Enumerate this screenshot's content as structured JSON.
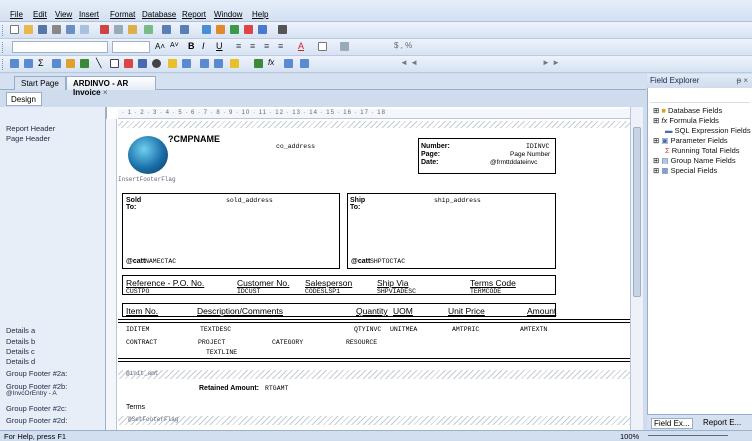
{
  "menu": {
    "file": "File",
    "edit": "Edit",
    "view": "View",
    "insert": "Insert",
    "format": "Format",
    "database": "Database",
    "report": "Report",
    "window": "Window",
    "help": "Help"
  },
  "tabs": {
    "start": "Start Page",
    "active": "ARDINVO - AR Invoice",
    "close": "×"
  },
  "design_tab": "Design",
  "sections": {
    "report_header": "Report Header",
    "page_header": "Page Header",
    "details_a": "Details a",
    "details_b": "Details b",
    "details_c": "Details c",
    "details_d": "Details d",
    "gf2a": "Group Footer #2a:",
    "gf2b": "Group Footer #2b:",
    "gf2b_sub": "@InvcOrEntry - A",
    "gf2c": "Group Footer #2c:",
    "gf2d": "Group Footer #2d:"
  },
  "ruler_text": "· 1 · 2 · 3 · 4 · 5 · 6 · 7 · 8 · 9 · 10 · 11 · 12 · 13 · 14 · 15 · 16 · 17 · 18",
  "report": {
    "company": "?CMPNAME",
    "co_address": "co_address",
    "insert_footer": "InsertFooterFlag",
    "number_lbl": "Number:",
    "page_lbl": "Page:",
    "date_lbl": "Date:",
    "idinvc": "IDINVC",
    "page_number": "Page Number",
    "date_field": "@frmttddateinvc",
    "sold_lbl": "Sold\nTo:",
    "sold_address": "sold_address",
    "ship_lbl": "Ship\nTo:",
    "ship_address": "ship_address",
    "attn_sold": "@catt",
    "namectac": "NAMECTAC",
    "attn_ship": "@catt",
    "shptoctac": "SHPTOCTAC",
    "ref_po": "Reference - P.O. No.",
    "customer_no": "Customer No.",
    "salesperson": "Salesperson",
    "ship_via": "Ship Via",
    "terms_code": "Terms Code",
    "custpo": "CUSTPO",
    "idcust": "IDCUST",
    "codeslsp1": "CODESLSP1",
    "shpviadesc": "SHPVIADESC",
    "termcode": "TERMCODE",
    "item_no": "Item No.",
    "description": "Description/Comments",
    "quantity": "Quantity",
    "uom": "UOM",
    "unit_price": "Unit Price",
    "amount": "Amount",
    "iditem": "IDITEM",
    "textdesc": "TEXTDESC",
    "qtyinvc": "QTYINVC",
    "unitmeas": "UNITMEA",
    "amtpric": "AMTPRIC",
    "amtextn": "AMTEXTN",
    "contract": "CONTRACT",
    "project": "PROJECT",
    "category": "CATEGORY",
    "resource": "RESOURCE",
    "textline": "TEXTLINE",
    "insert_amt": "@init_amt",
    "retained_lbl": "Retained Amount:",
    "rtgamt": "RTGAMT",
    "terms": "Terms",
    "set_footer": "@SetFooterFlag"
  },
  "explorer": {
    "title": "Field Explorer",
    "pin": "ᵽ ×",
    "items": [
      "Database Fields",
      "Formula Fields",
      "SQL Expression Fields",
      "Parameter Fields",
      "Running Total Fields",
      "Group Name Fields",
      "Special Fields"
    ],
    "bottom_tab1": "Field Ex...",
    "bottom_tab2": "Report E..."
  },
  "status": {
    "help": "For Help, press F1",
    "zoom": "100%"
  }
}
